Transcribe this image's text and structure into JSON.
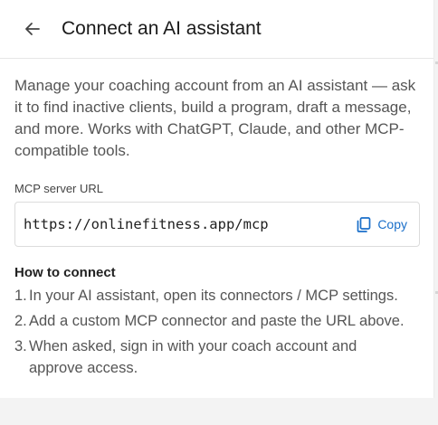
{
  "header": {
    "title": "Connect an AI assistant"
  },
  "description": "Manage your coaching account from an AI assistant — ask it to find inactive clients, build a program, draft a message, and more. Works with ChatGPT, Claude, and other MCP-compatible tools.",
  "server": {
    "label": "MCP server URL",
    "url": "https://onlinefitness.app/mcp",
    "copy_label": "Copy"
  },
  "how_to": {
    "title": "How to connect",
    "steps": [
      {
        "num": "1.",
        "text": "In your AI assistant, open its connectors / MCP settings."
      },
      {
        "num": "2.",
        "text": "Add a custom MCP connector and paste the URL above."
      },
      {
        "num": "3.",
        "text": "When asked, sign in with your coach account and approve access."
      }
    ]
  },
  "colors": {
    "accent": "#1a6fc9",
    "background": "#f3f3f3",
    "panel": "#ffffff"
  },
  "icons": {
    "back": "arrow-left-icon",
    "copy": "copy-icon"
  }
}
